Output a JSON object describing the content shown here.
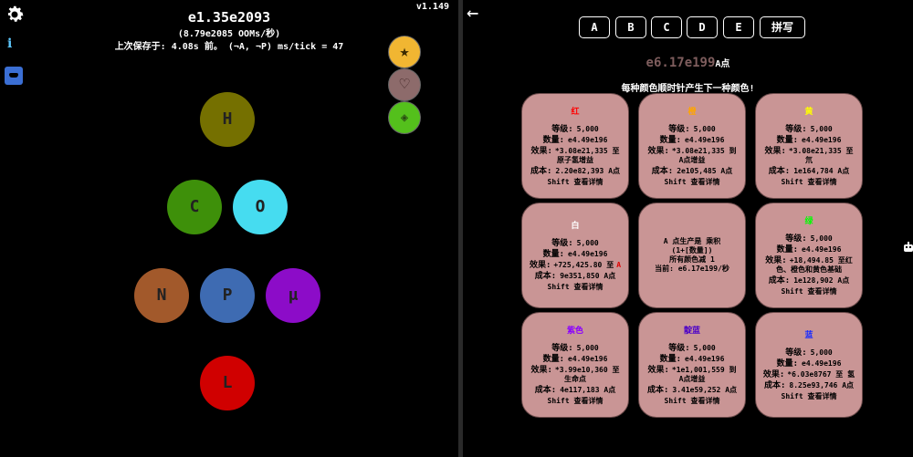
{
  "left": {
    "main_value": "e1.35e2093",
    "rate": "(8.79e2085 OOMs/秒)",
    "save_status": "上次保存于:  4.08s 前。  (¬A, ¬P) ms/tick = 47",
    "version": "v1.149",
    "info_label": "i",
    "side_buttons": [
      "★",
      "♡",
      "◈"
    ],
    "elements": {
      "H": "H",
      "C": "C",
      "O": "O",
      "N": "N",
      "P": "P",
      "mu": "μ",
      "L": "L"
    }
  },
  "right": {
    "back_label": "←",
    "tabs": [
      "A",
      "B",
      "C",
      "D",
      "E",
      "拼写"
    ],
    "amount_value": "e6.17e199",
    "amount_unit": "A点",
    "hint": "每种颜色顺时针产生下一种颜色!",
    "cards": [
      {
        "name": "红",
        "name_color": "#ff0000",
        "level_label": "等级:",
        "level": "5,000",
        "qty_label": "数量:",
        "qty": "e4.49e196",
        "effect_label": "效果:",
        "effect": "*3.08e21,335 至 原子氢增益",
        "cost_label": "成本:",
        "cost": "2.20e82,393 A点",
        "shift": "Shift 查看详情"
      },
      {
        "name": "橙",
        "name_color": "#ffa500",
        "level_label": "等级:",
        "level": "5,000",
        "qty_label": "数量:",
        "qty": "e4.49e196",
        "effect_label": "效果:",
        "effect": "*3.08e21,335 到 A点增益",
        "cost_label": "成本:",
        "cost": "2e105,485 A点",
        "shift": "Shift 查看详情"
      },
      {
        "name": "黄",
        "name_color": "#ffff00",
        "level_label": "等级:",
        "level": "5,000",
        "qty_label": "数量:",
        "qty": "e4.49e196",
        "effect_label": "效果:",
        "effect": "*3.08e21,335 至 氘",
        "cost_label": "成本:",
        "cost": "1e164,784 A点",
        "shift": "Shift 查看详情"
      },
      {
        "name": "白",
        "name_color": "#ffffff",
        "level_label": "等级:",
        "level": "5,000",
        "qty_label": "数量:",
        "qty": "e4.49e196",
        "effect_label": "效果:",
        "effect": "+725,425.80 至",
        "effect_tail": "A",
        "cost_label": "成本:",
        "cost": "9e351,850 A点",
        "shift": "Shift 查看详情"
      },
      {
        "center": true,
        "lines": [
          "A 点生产是 乘积",
          "(1+[数量])",
          "所有颜色减 1",
          "当前: e6.17e199/秒"
        ]
      },
      {
        "name": "绿",
        "name_color": "#00ff00",
        "level_label": "等级:",
        "level": "5,000",
        "qty_label": "数量:",
        "qty": "e4.49e196",
        "effect_label": "效果:",
        "effect": "+18,494.85 至红色、橙色和黄色基础",
        "cost_label": "成本:",
        "cost": "1e128,902 A点",
        "shift": "Shift 查看详情"
      },
      {
        "name": "紫色",
        "name_color": "#8a00ff",
        "level_label": "等级:",
        "level": "5,000",
        "qty_label": "数量:",
        "qty": "e4.49e196",
        "effect_label": "效果:",
        "effect": "*3.99e10,360 至 生命点",
        "cost_label": "成本:",
        "cost": "4e117,183 A点",
        "shift": "Shift 查看详情"
      },
      {
        "name": "靛蓝",
        "name_color": "#4b00c8",
        "level_label": "等级:",
        "level": "5,000",
        "qty_label": "数量:",
        "qty": "e4.49e196",
        "effect_label": "效果:",
        "effect": "*1e1,001,559 到 A点增益",
        "cost_label": "成本:",
        "cost": "3.41e59,252 A点",
        "shift": "Shift 查看详情"
      },
      {
        "name": "蓝",
        "name_color": "#1a2cff",
        "level_label": "等级:",
        "level": "5,000",
        "qty_label": "数量:",
        "qty": "e4.49e196",
        "effect_label": "效果:",
        "effect": "*6.03e8767 至 氢",
        "cost_label": "成本:",
        "cost": "8.25e93,746 A点",
        "shift": "Shift 查看详情"
      }
    ]
  }
}
